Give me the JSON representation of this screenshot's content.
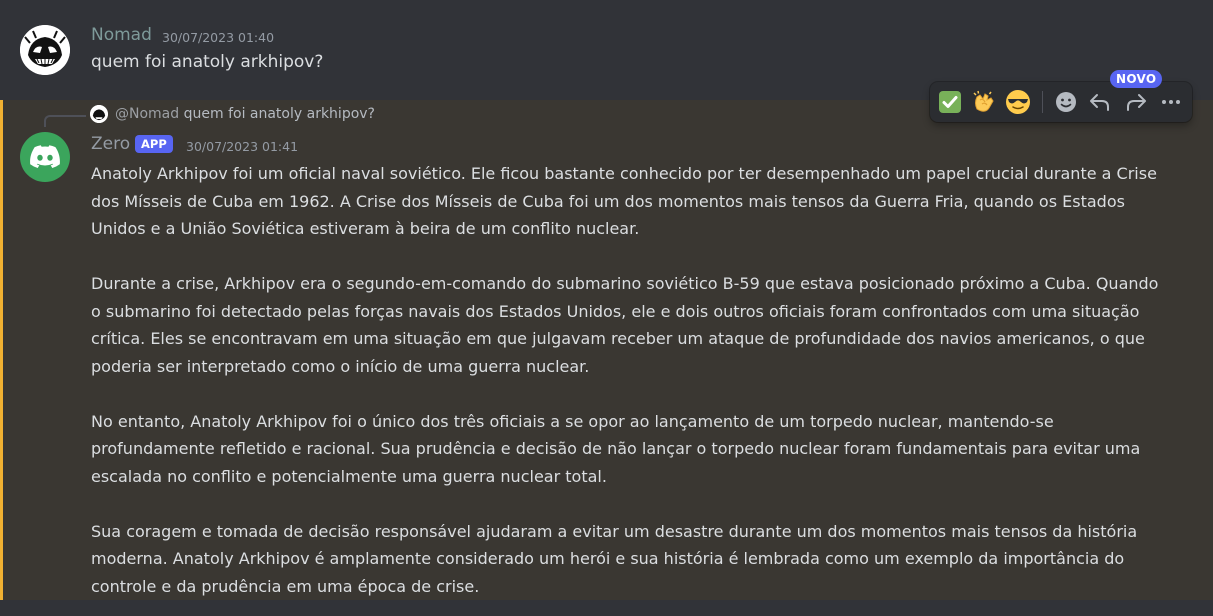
{
  "message1": {
    "author": "Nomad",
    "author_color": "#7e9a9a",
    "timestamp": "30/07/2023 01:40",
    "text": "quem foi anatoly arkhipov?"
  },
  "message2": {
    "reply": {
      "mention": "@Nomad",
      "text": "quem foi anatoly arkhipov?"
    },
    "author": "Zero",
    "author_color": "#949ba4",
    "badge": "APP",
    "timestamp": "30/07/2023 01:41",
    "paragraphs": [
      "Anatoly Arkhipov foi um oficial naval soviético. Ele ficou bastante conhecido por ter desempenhado um papel crucial durante a Crise dos Mísseis de Cuba em 1962. A Crise dos Mísseis de Cuba foi um dos momentos mais tensos da Guerra Fria, quando os Estados Unidos e a União Soviética estiveram à beira de um conflito nuclear.",
      "Durante a crise, Arkhipov era o segundo-em-comando do submarino soviético B-59 que estava posicionado próximo a Cuba. Quando o submarino foi detectado pelas forças navais dos Estados Unidos, ele e dois outros oficiais foram confrontados com uma situação crítica. Eles se encontravam em uma situação em que julgavam receber um ataque de profundidade dos navios americanos, o que poderia ser interpretado como o início de uma guerra nuclear.",
      "No entanto, Anatoly Arkhipov foi o único dos três oficiais a se opor ao lançamento de um torpedo nuclear, mantendo-se profundamente refletido e racional. Sua prudência e decisão de não lançar o torpedo nuclear foram fundamentais para evitar uma escalada no conflito e potencialmente uma guerra nuclear total.",
      "Sua coragem e tomada de decisão responsável ajudaram a evitar um desastre durante um dos momentos mais tensos da história moderna. Anatoly Arkhipov é amplamente considerado um herói e sua história é lembrada como um exemplo da importância do controle e da prudência em uma época de crise."
    ]
  },
  "toolbar": {
    "new_badge": "NOVO",
    "items": [
      {
        "icon": "check-emoji"
      },
      {
        "icon": "clapping-hands-emoji"
      },
      {
        "icon": "sunglasses-emoji"
      },
      {
        "icon": "add-reaction-icon"
      },
      {
        "icon": "reply-icon"
      },
      {
        "icon": "forward-icon"
      },
      {
        "icon": "more-icon"
      }
    ]
  },
  "colors": {
    "background": "#313338",
    "highlight_bg": "#3a3732",
    "highlight_bar": "#f0b132",
    "brand": "#5865f2",
    "bot_avatar": "#3ba55c"
  }
}
